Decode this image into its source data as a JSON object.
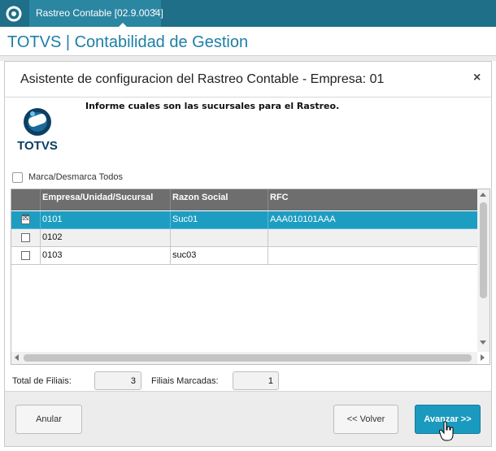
{
  "topbar": {
    "home_icon": "totvs-home-icon",
    "tab": {
      "label": "Rastreo Contable [02.9.0034]",
      "close": "×"
    }
  },
  "app": {
    "title": "TOTVS | Contabilidad de Gestion"
  },
  "dialog": {
    "title": "Asistente de configuracion del Rastreo Contable - Empresa: 01",
    "close": "×",
    "logo_text": "TOTVS",
    "instruction": "Informe cuales son las sucursales para el Rastreo.",
    "mark_all_label": "Marca/Desmarca Todos"
  },
  "grid": {
    "columns": [
      "",
      "Empresa/Unidad/Sucursal",
      "Razon Social",
      "RFC"
    ],
    "rows": [
      {
        "checked": true,
        "check_glyph": "☒",
        "code": "0101",
        "razon": "Suc01",
        "rfc": "AAA010101AAA"
      },
      {
        "checked": false,
        "check_glyph": "",
        "code": "0102",
        "razon": "",
        "rfc": ""
      },
      {
        "checked": false,
        "check_glyph": "",
        "code": "0103",
        "razon": "suc03",
        "rfc": ""
      }
    ]
  },
  "summary": {
    "total_label": "Total de Filiais:",
    "total_value": "3",
    "marked_label": "Filiais Marcadas:",
    "marked_value": "1"
  },
  "buttons": {
    "anular": "Anular",
    "volver": "<< Volver",
    "avanzar": "Avanzar >>"
  },
  "colors": {
    "topbar": "#1f6f88",
    "accent": "#1d7fa6",
    "selected_row": "#1e9dc2",
    "primary_button": "#1b9ac0",
    "grid_header": "#6e6e6e"
  }
}
